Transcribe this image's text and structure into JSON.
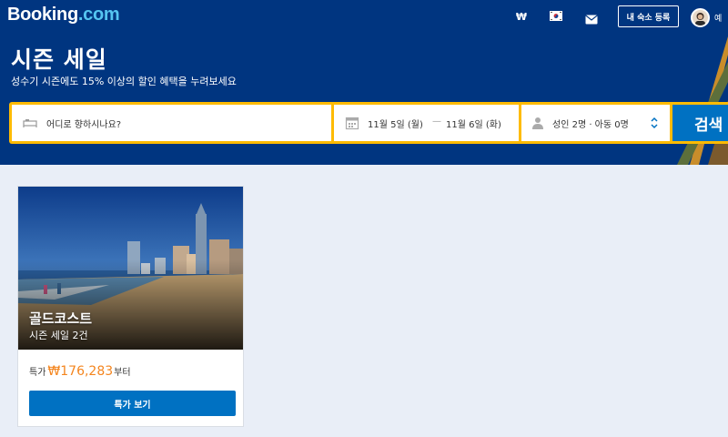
{
  "brand": {
    "name_main": "Booking",
    "name_tld": ".com"
  },
  "topbar": {
    "currency": "₩",
    "list_property_label": "내 숙소 등록",
    "user_name": "예"
  },
  "hero": {
    "title": "시즌 세일",
    "subtitle": "성수기 시즌에도 15% 이상의 할인 혜택을 누려보세요"
  },
  "search": {
    "destination_placeholder": "어디로 향하시나요?",
    "checkin": "11월 5일 (월)",
    "date_separator": "—",
    "checkout": "11월 6일 (화)",
    "guests": "성인 2명 · 아동 0명",
    "submit_label": "검색"
  },
  "deal_card": {
    "title": "골드코스트",
    "subtitle": "시즌 세일 2건",
    "price_prefix": "특가",
    "price": "₩176,283",
    "price_suffix": "부터",
    "button_label": "특가 보기"
  },
  "colors": {
    "brand_blue": "#003580",
    "search_yellow": "#febb02",
    "action_blue": "#0071c2",
    "price_orange": "#f4851e"
  }
}
